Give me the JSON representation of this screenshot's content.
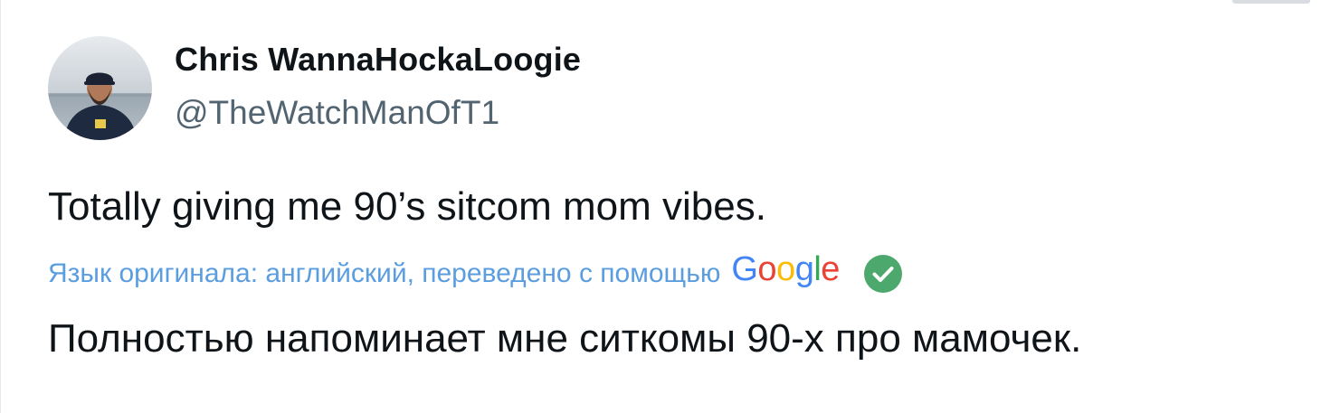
{
  "tweet": {
    "author": {
      "name": "Chris WannaHockaLoogie",
      "handle": "@TheWatchManOfT1"
    },
    "text": "Totally giving me 90’s sitcom mom vibes.",
    "translation": {
      "note": "Язык оригинала: английский, переведено с помощью",
      "provider_letters": [
        "G",
        "o",
        "o",
        "g",
        "l",
        "e"
      ],
      "text": "Полностью напоминает мне ситкомы 90-х про мамочек."
    }
  },
  "icons": {
    "avatar": "avatar",
    "verified": "check-circle-icon"
  },
  "colors": {
    "name": "#0f1419",
    "handle": "#536471",
    "translation_note": "#5b9ee0",
    "check_badge": "#4ca86c",
    "google_blue": "#4285f4",
    "google_red": "#ea4335",
    "google_yellow": "#fbbc05",
    "google_green": "#34a853"
  }
}
